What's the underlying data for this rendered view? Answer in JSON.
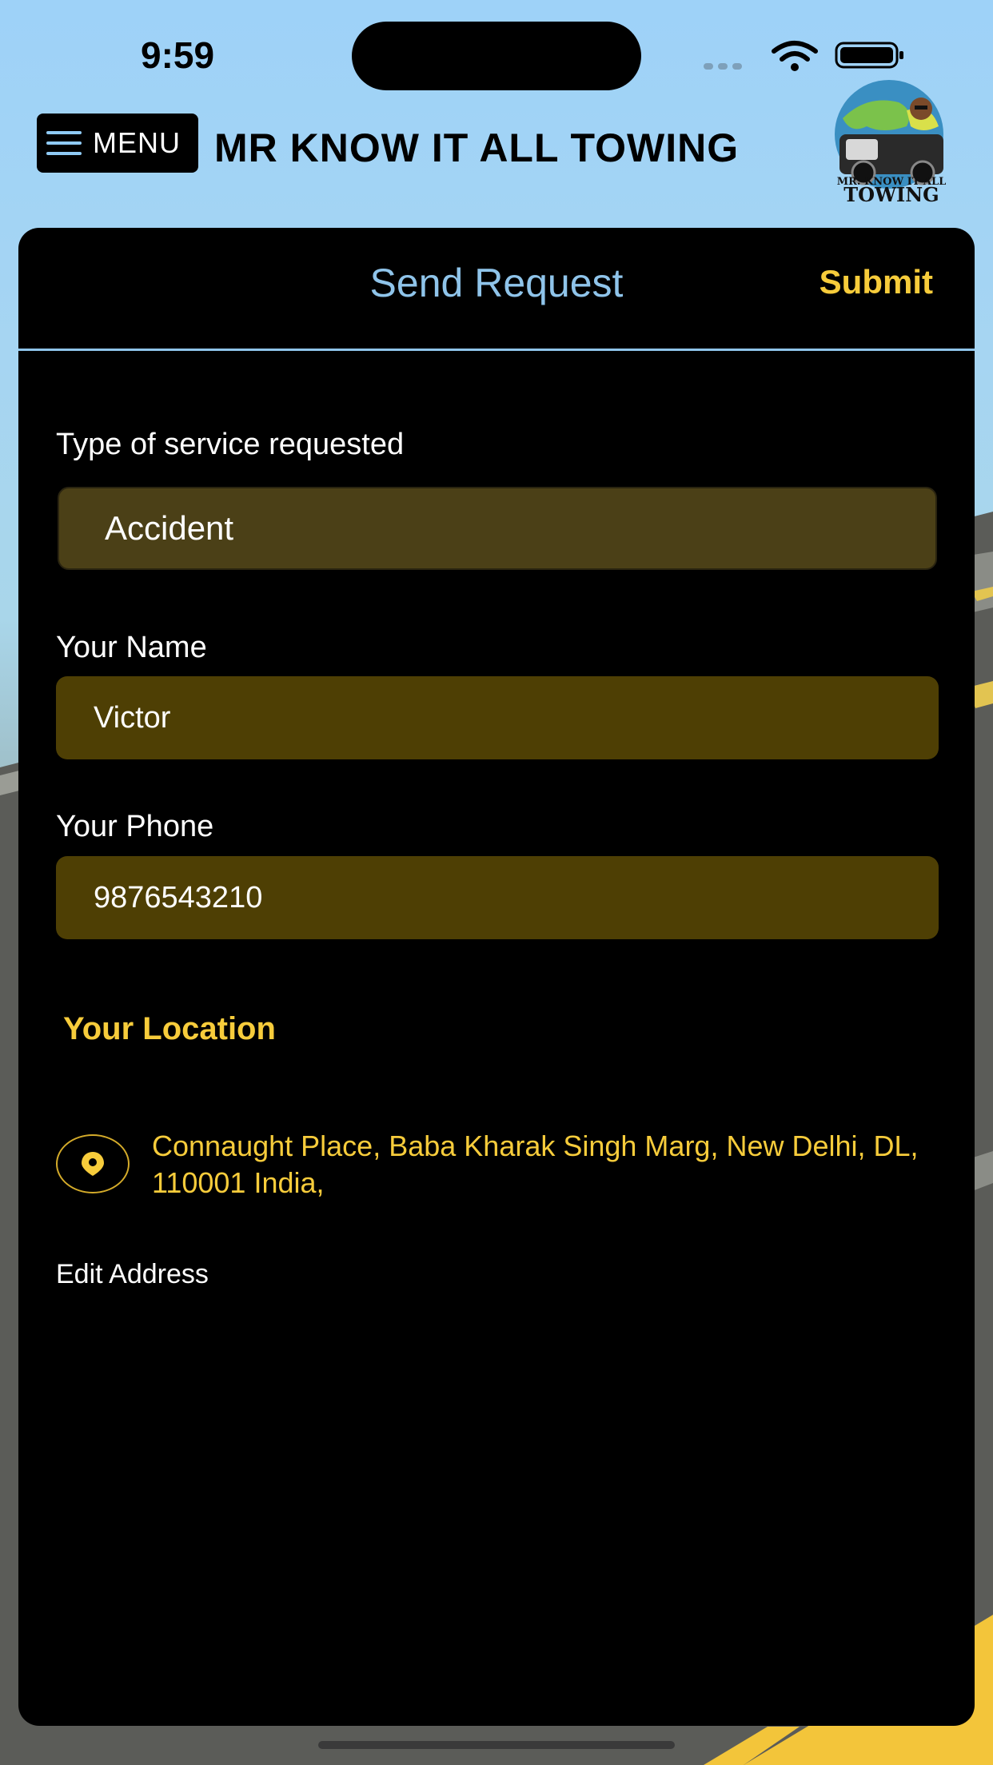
{
  "status_bar": {
    "time": "9:59"
  },
  "header": {
    "menu_label": "MENU",
    "app_title": "MR KNOW IT ALL TOWING",
    "logo_text_small": "MR. KNOW IT ALL",
    "logo_text_big": "TOWING"
  },
  "card": {
    "title": "Send Request",
    "submit_label": "Submit"
  },
  "form": {
    "service_label": "Type of service requested",
    "service_value": "Accident",
    "name_label": "Your Name",
    "name_value": "Victor",
    "phone_label": "Your Phone",
    "phone_value": "9876543210"
  },
  "location": {
    "heading": "Your Location",
    "address": "Connaught Place, Baba Kharak Singh Marg, New Delhi, DL, 110001 India,",
    "edit_label": "Edit Address"
  },
  "colors": {
    "accent_yellow": "#f7cc3b",
    "accent_blue": "#8fc4ea",
    "field_bg": "#4e3f04",
    "card_bg": "#000000"
  },
  "icons": [
    "menu-icon",
    "location-pin-icon",
    "wifi-icon",
    "battery-icon",
    "signal-icon"
  ]
}
